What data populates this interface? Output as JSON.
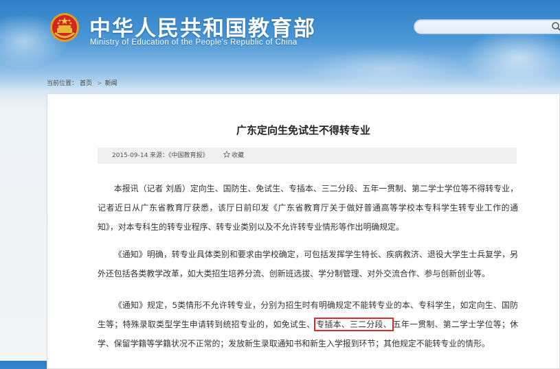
{
  "header": {
    "site_title": "中华人民共和国教育部",
    "site_subtitle": "Ministry of Education of the People's Republic of China",
    "search": {
      "value": "",
      "placeholder": ""
    }
  },
  "breadcrumb": {
    "label": "当前位置：",
    "items": [
      "首页",
      "新闻"
    ],
    "separator": ">"
  },
  "article": {
    "title": "广东定向生免试生不得转专业",
    "meta": {
      "date": "2015-09-14",
      "source": "来源：《中国教育报》",
      "favorite": "收藏"
    },
    "paragraphs": [
      "本报讯（记者 刘盾）定向生、国防生、免试生、专插本、三二分段、五年一贯制、第二学士学位等不得转专业，记者近日从广东省教育厅获悉，该厅日前印发《广东省教育厅关于做好普通高等学校本专科学生转专业工作的通知》，对本专科生的转专业程序、转专业类别以及不允许转专业情形等作出明确规定。",
      "《通知》明确，转专业具体类别和要求由学校确定，可包括发挥学生特长、疾病救济、退役大学生士兵复学，另外还包括各类教学改革，如大类招生培养分流、创新班选拔、学分制管理、对外交流合作、参与创新创业等。"
    ],
    "paragraph3": {
      "before": "《通知》规定，5类情形不允许转专业，分别为招生时有明确规定不能转专业的本、专科学生，如定向生、国防生等；特殊录取类型学生申请转到统招专业的，如免试生、",
      "highlight": "专插本、三二分段、",
      "after": "五年一贯制、第二学士学位等；休学、保留学籍等学籍状况不正常的；发放新生录取通知书和新生入学报到环节；其他规定不能转专业的情形。"
    }
  },
  "colors": {
    "header_blue": "#2d7fc8",
    "highlight_border": "#e4262c",
    "meta_bar": "#f0f0f0"
  },
  "icons": [
    "national-emblem-icon",
    "search-icon",
    "star-icon"
  ]
}
